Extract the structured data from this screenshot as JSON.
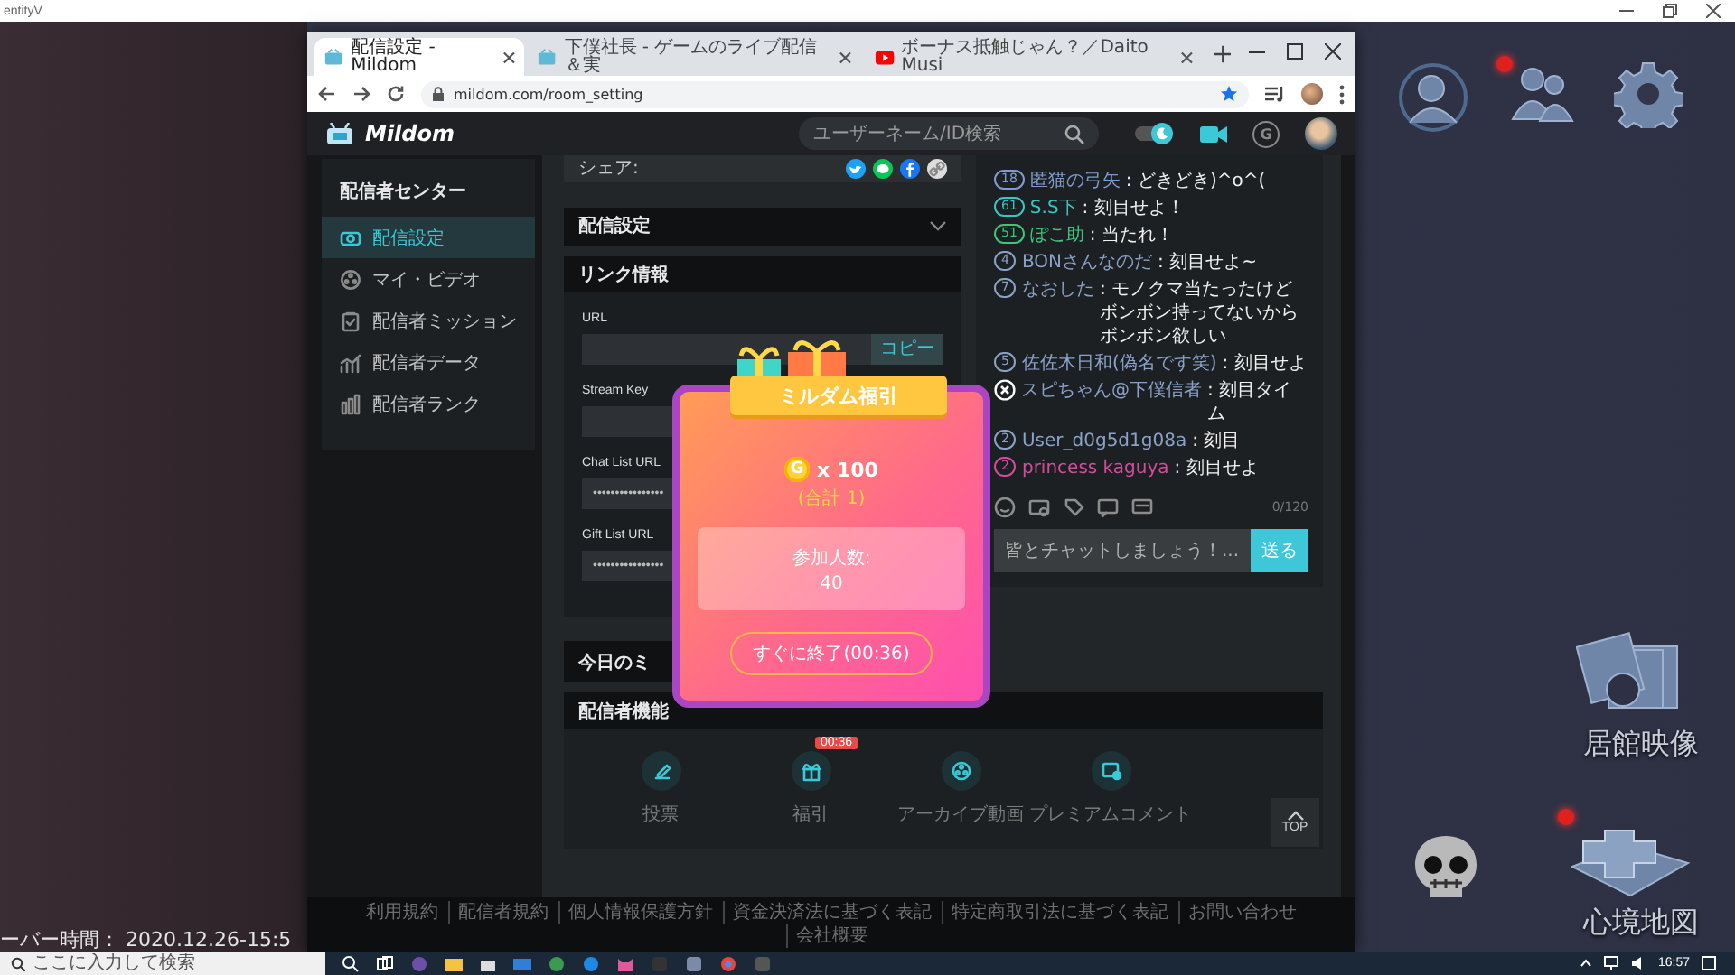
{
  "desktop": {
    "window_title": "entityV",
    "server_time": "ーバー時間： 2020.12.26-15:5",
    "shortcuts": [
      {
        "label": "居館映像"
      },
      {
        "label": "心境地図"
      }
    ]
  },
  "browser": {
    "tabs": [
      {
        "title": "配信設定 - Mildom",
        "selected": true
      },
      {
        "title": "下僕社長 - ゲームのライブ配信＆実",
        "selected": false
      },
      {
        "title": "ボーナス抵触じゃん？／Daito Musi",
        "selected": false
      }
    ],
    "url": "mildom.com/room_setting"
  },
  "site_header": {
    "logo": "Mildom",
    "search_placeholder": "ユーザーネーム/ID検索",
    "coin": "G"
  },
  "sidebar": {
    "title": "配信者センター",
    "items": [
      {
        "label": "配信設定",
        "selected": true
      },
      {
        "label": "マイ・ビデオ",
        "selected": false
      },
      {
        "label": "配信者ミッション",
        "selected": false
      },
      {
        "label": "配信者データ",
        "selected": false
      },
      {
        "label": "配信者ランク",
        "selected": false
      }
    ]
  },
  "share": {
    "label": "シェア:"
  },
  "stream_settings": {
    "title": "配信設定"
  },
  "link_info": {
    "title": "リンク情報",
    "fields": [
      {
        "label": "URL",
        "copy": "コピー"
      },
      {
        "label": "Stream Key"
      },
      {
        "label": "Chat List URL",
        "value": "••••••••••••••••"
      },
      {
        "label": "Gift List URL",
        "value": "••••••••••••••••"
      }
    ]
  },
  "mission": {
    "title": "今日のミ"
  },
  "chat": {
    "messages": [
      {
        "kind": "level",
        "level": "18",
        "name": "匿猫の弓矢",
        "text": ": どきどき)^o^(",
        "color": "#7f9cd0"
      },
      {
        "kind": "level",
        "level": "61",
        "name": "S.S下",
        "text": ": 刻目せよ！",
        "color": "#3cc4c4"
      },
      {
        "kind": "level",
        "level": "51",
        "name": "ぽこ助",
        "text": ": 当たれ！",
        "color": "#42c47a"
      },
      {
        "kind": "level",
        "level": "4",
        "name": "BONさんなのだ",
        "text": ": 刻目せよ~",
        "color": "#8aa2c8"
      },
      {
        "kind": "level",
        "level": "7",
        "name": "なおした",
        "text": ": モノクマ当たったけどボンボン持ってないからボンボン欲しい",
        "color": "#8aa2c8"
      },
      {
        "kind": "level",
        "level": "5",
        "name": "佐佐木日和(偽名です笑)",
        "text": ": 刻目せよ",
        "color": "#8aa2c8"
      },
      {
        "kind": "banned",
        "name": "スピちゃん@下僕信者",
        "text": ": 刻目タイム",
        "color": "#8aa2c8"
      },
      {
        "kind": "level",
        "level": "2",
        "name": "User_d0g5d1g08a",
        "text": ": 刻目",
        "color": "#8aa2c8"
      },
      {
        "kind": "level",
        "level": "2",
        "name": "princess kaguya",
        "text": ": 刻目せよ",
        "color": "#d04d9c"
      }
    ],
    "counter": "0/120",
    "placeholder": "皆とチャットしましょう！...",
    "send": "送る"
  },
  "features": {
    "title": "配信者機能",
    "items": [
      {
        "label": "投票"
      },
      {
        "label": "福引",
        "badge": "00:36"
      },
      {
        "label": "アーカイブ動画"
      },
      {
        "label": "プレミアムコメント"
      }
    ]
  },
  "top_button": "TOP",
  "lottery": {
    "title": "ミルダム福引",
    "coin": "G",
    "amount": "x 100",
    "total": "(合計 1)",
    "participants_label": "参加人数:",
    "participants": "40",
    "end_button": "すぐに終了(00:36)"
  },
  "footer": {
    "links": [
      "利用規約",
      "配信者規約",
      "個人情報保護方針",
      "資金決済法に基づく表記",
      "特定商取引法に基づく表記",
      "お問い合わせ",
      "会社概要"
    ]
  },
  "taskbar": {
    "search_placeholder": "ここに入力して検索",
    "clock": "16:57"
  }
}
